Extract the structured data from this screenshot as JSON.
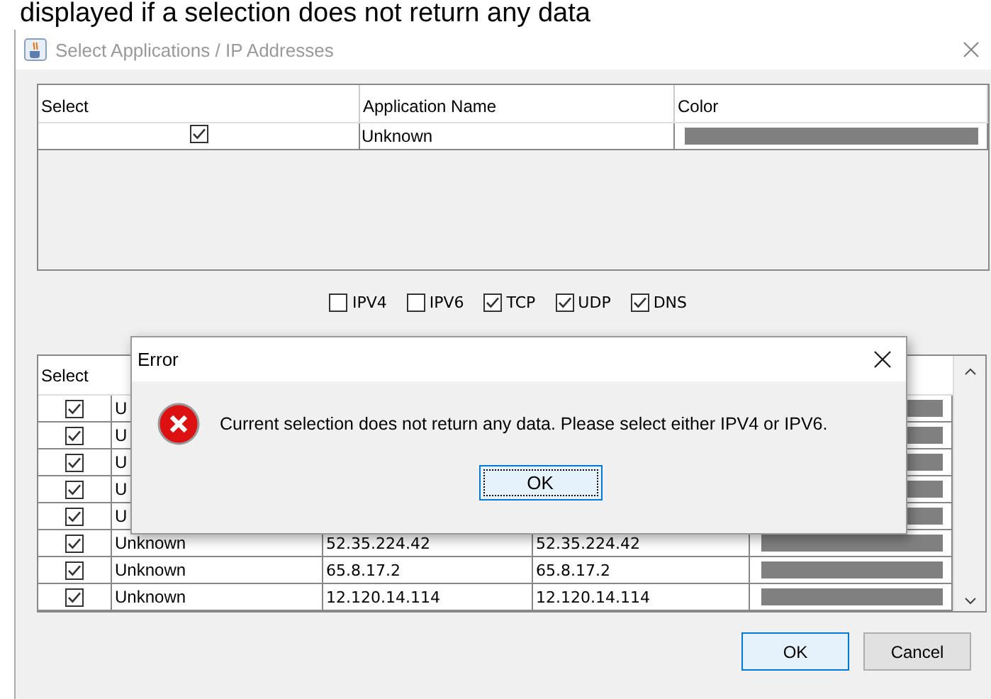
{
  "caption": "displayed if a selection does not return any data",
  "window": {
    "title": "Select Applications / IP Addresses"
  },
  "app_table": {
    "columns": [
      "Select",
      "Application Name",
      "Color"
    ],
    "rows": [
      {
        "checked": true,
        "name": "Unknown"
      }
    ]
  },
  "filters": [
    {
      "label": "IPV4",
      "checked": false
    },
    {
      "label": "IPV6",
      "checked": false
    },
    {
      "label": "TCP",
      "checked": true
    },
    {
      "label": "UDP",
      "checked": true
    },
    {
      "label": "DNS",
      "checked": true
    }
  ],
  "ip_table": {
    "columns": [
      "Select"
    ],
    "rows": [
      {
        "checked": true,
        "name": "U"
      },
      {
        "checked": true,
        "name": "U"
      },
      {
        "checked": true,
        "name": "U"
      },
      {
        "checked": true,
        "name": "U"
      },
      {
        "checked": true,
        "name": "U"
      },
      {
        "checked": true,
        "name": "Unknown",
        "column_3": "52.35.224.42",
        "column_4": "52.35.224.42"
      },
      {
        "checked": true,
        "name": "Unknown",
        "column_3": "65.8.17.2",
        "column_4": "65.8.17.2"
      },
      {
        "checked": true,
        "name": "Unknown",
        "column_3": "12.120.14.114",
        "column_4": "12.120.14.114"
      }
    ]
  },
  "buttons": [
    {
      "label": "OK",
      "default": true
    },
    {
      "label": "Cancel",
      "default": false
    }
  ],
  "dialog": {
    "title": "Error",
    "message": "Current selection does not return any data. Please select either IPV4 or IPV6.",
    "button": "OK"
  }
}
